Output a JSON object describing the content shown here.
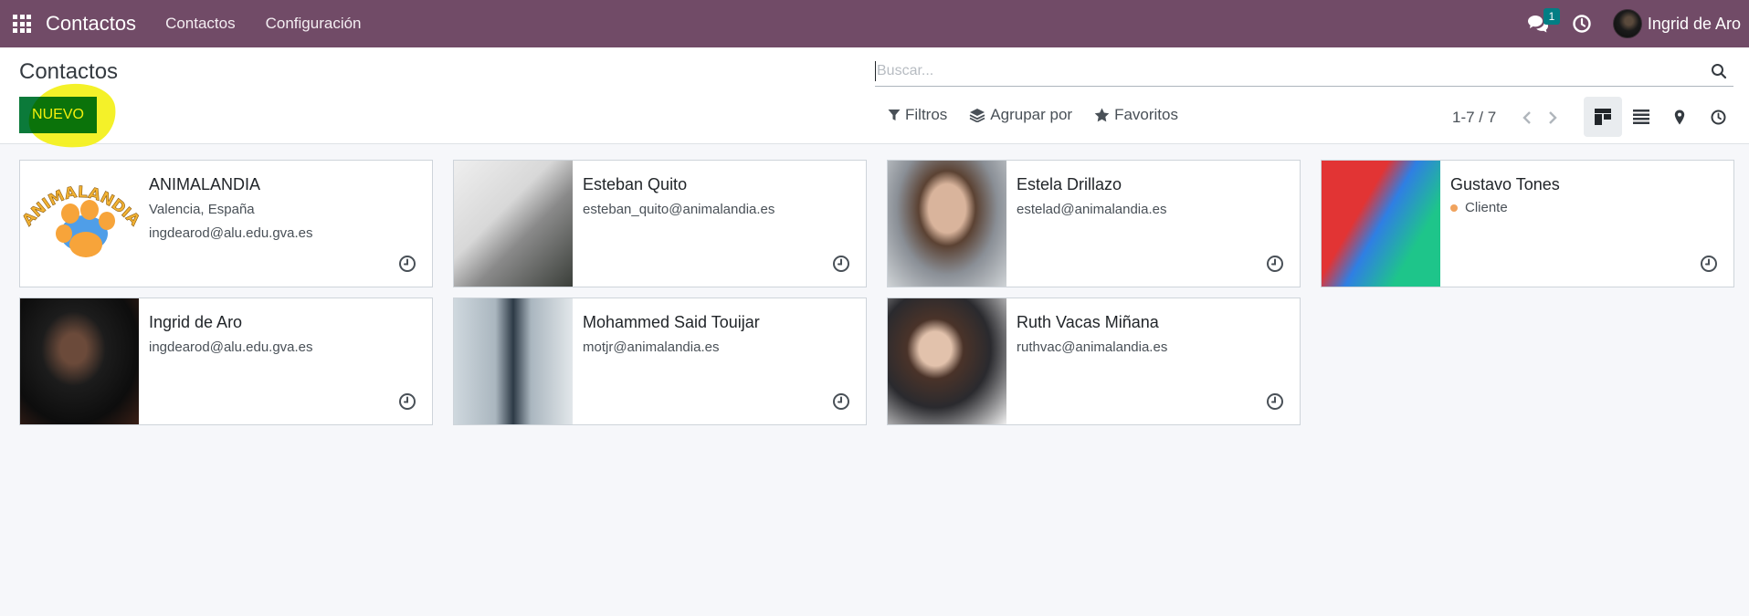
{
  "navbar": {
    "app_name": "Contactos",
    "menu": [
      "Contactos",
      "Configuración"
    ],
    "chat_badge": "1",
    "user_name": "Ingrid de Aro",
    "color": "#714b67"
  },
  "control": {
    "breadcrumb": "Contactos",
    "new_button": "NUEVO",
    "search_placeholder": "Buscar...",
    "filters_label": "Filtros",
    "group_label": "Agrupar por",
    "favorites_label": "Favoritos",
    "pager": "1-7 / 7"
  },
  "icons": {
    "apps": "apps-grid-icon",
    "chat": "chat-icon",
    "clock": "clock-icon",
    "search": "search-icon",
    "filter": "filter-icon",
    "layers": "layers-icon",
    "star": "star-icon",
    "kanban": "kanban-view-icon",
    "list": "list-view-icon",
    "map": "map-pin-icon",
    "activity": "activity-view-icon"
  },
  "contacts": [
    {
      "name": "ANIMALANDIA",
      "line1": "Valencia, España",
      "line2": "ingdearod@alu.edu.gva.es",
      "tag": ""
    },
    {
      "name": "Esteban Quito",
      "line1": "esteban_quito@animalandia.es",
      "line2": "",
      "tag": ""
    },
    {
      "name": "Estela Drillazo",
      "line1": "estelad@animalandia.es",
      "line2": "",
      "tag": ""
    },
    {
      "name": "Gustavo Tones",
      "line1": "",
      "line2": "",
      "tag": "Cliente"
    },
    {
      "name": "Ingrid de Aro",
      "line1": "ingdearod@alu.edu.gva.es",
      "line2": "",
      "tag": ""
    },
    {
      "name": "Mohammed Said Touijar",
      "line1": "motjr@animalandia.es",
      "line2": "",
      "tag": ""
    },
    {
      "name": "Ruth Vacas Miñana",
      "line1": "ruthvac@animalandia.es",
      "line2": "",
      "tag": ""
    }
  ],
  "logo_text": "ANIMALANDIA"
}
